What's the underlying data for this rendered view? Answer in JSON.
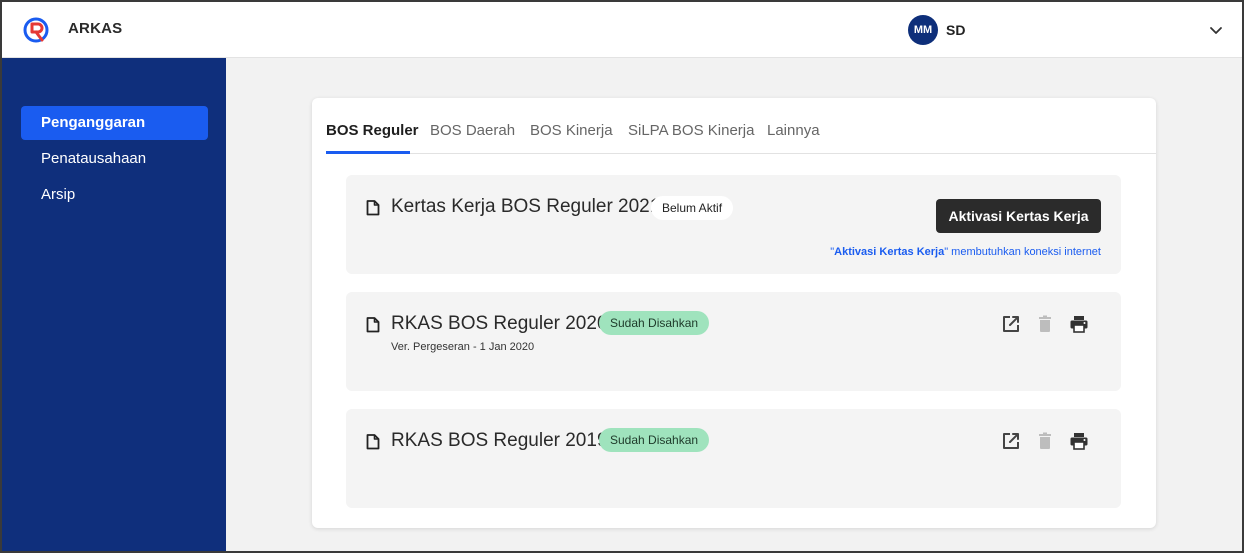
{
  "app": {
    "name": "ARKAS"
  },
  "user": {
    "initials": "MM",
    "name": "SD"
  },
  "sidebar": {
    "items": [
      {
        "label": "Penganggaran",
        "active": true
      },
      {
        "label": "Penatausahaan",
        "active": false
      },
      {
        "label": "Arsip",
        "active": false
      }
    ]
  },
  "tabs": [
    {
      "label": "BOS Reguler",
      "active": true
    },
    {
      "label": "BOS Daerah",
      "active": false
    },
    {
      "label": "BOS Kinerja",
      "active": false
    },
    {
      "label": "SiLPA BOS Kinerja",
      "active": false
    },
    {
      "label": "Lainnya",
      "active": false
    }
  ],
  "panels": {
    "worksheet": {
      "title": "Kertas Kerja BOS Reguler 2021",
      "status": "Belum Aktif",
      "button": "Aktivasi Kertas Kerja",
      "note_quote_open": "\"",
      "note_bold": "Aktivasi Kertas Kerja",
      "note_rest": "\" membutuhkan koneksi internet"
    },
    "rkas2020": {
      "title": "RKAS BOS Reguler 2020",
      "status": "Sudah Disahkan",
      "version": "Ver. Pergeseran - 1 Jan 2020"
    },
    "rkas2019": {
      "title": "RKAS BOS Reguler 2019",
      "status": "Sudah Disahkan"
    }
  },
  "icons": {
    "logo": "arkas-logo-icon",
    "chevron": "chevron-down-icon",
    "document": "document-icon",
    "open": "open-external-icon",
    "delete": "trash-icon",
    "print": "printer-icon"
  },
  "colors": {
    "sidebar": "#0f2f7c",
    "accent": "#1a5cf0",
    "approved_badge": "#9fe3bd",
    "primary_button": "#2b2b2b"
  }
}
